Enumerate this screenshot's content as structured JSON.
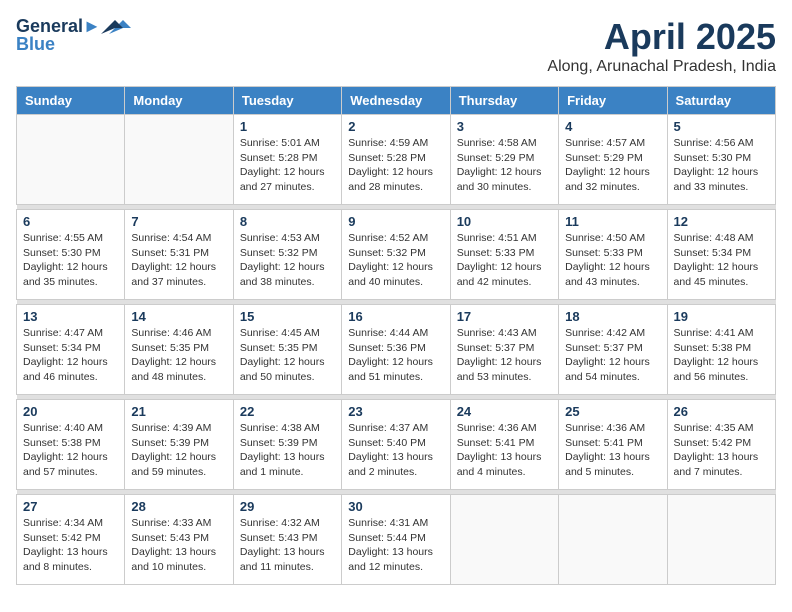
{
  "header": {
    "logo_line1": "General",
    "logo_line2": "Blue",
    "month_title": "April 2025",
    "location": "Along, Arunachal Pradesh, India"
  },
  "weekdays": [
    "Sunday",
    "Monday",
    "Tuesday",
    "Wednesday",
    "Thursday",
    "Friday",
    "Saturday"
  ],
  "weeks": [
    [
      {
        "day": "",
        "info": ""
      },
      {
        "day": "",
        "info": ""
      },
      {
        "day": "1",
        "info": "Sunrise: 5:01 AM\nSunset: 5:28 PM\nDaylight: 12 hours and 27 minutes."
      },
      {
        "day": "2",
        "info": "Sunrise: 4:59 AM\nSunset: 5:28 PM\nDaylight: 12 hours and 28 minutes."
      },
      {
        "day": "3",
        "info": "Sunrise: 4:58 AM\nSunset: 5:29 PM\nDaylight: 12 hours and 30 minutes."
      },
      {
        "day": "4",
        "info": "Sunrise: 4:57 AM\nSunset: 5:29 PM\nDaylight: 12 hours and 32 minutes."
      },
      {
        "day": "5",
        "info": "Sunrise: 4:56 AM\nSunset: 5:30 PM\nDaylight: 12 hours and 33 minutes."
      }
    ],
    [
      {
        "day": "6",
        "info": "Sunrise: 4:55 AM\nSunset: 5:30 PM\nDaylight: 12 hours and 35 minutes."
      },
      {
        "day": "7",
        "info": "Sunrise: 4:54 AM\nSunset: 5:31 PM\nDaylight: 12 hours and 37 minutes."
      },
      {
        "day": "8",
        "info": "Sunrise: 4:53 AM\nSunset: 5:32 PM\nDaylight: 12 hours and 38 minutes."
      },
      {
        "day": "9",
        "info": "Sunrise: 4:52 AM\nSunset: 5:32 PM\nDaylight: 12 hours and 40 minutes."
      },
      {
        "day": "10",
        "info": "Sunrise: 4:51 AM\nSunset: 5:33 PM\nDaylight: 12 hours and 42 minutes."
      },
      {
        "day": "11",
        "info": "Sunrise: 4:50 AM\nSunset: 5:33 PM\nDaylight: 12 hours and 43 minutes."
      },
      {
        "day": "12",
        "info": "Sunrise: 4:48 AM\nSunset: 5:34 PM\nDaylight: 12 hours and 45 minutes."
      }
    ],
    [
      {
        "day": "13",
        "info": "Sunrise: 4:47 AM\nSunset: 5:34 PM\nDaylight: 12 hours and 46 minutes."
      },
      {
        "day": "14",
        "info": "Sunrise: 4:46 AM\nSunset: 5:35 PM\nDaylight: 12 hours and 48 minutes."
      },
      {
        "day": "15",
        "info": "Sunrise: 4:45 AM\nSunset: 5:35 PM\nDaylight: 12 hours and 50 minutes."
      },
      {
        "day": "16",
        "info": "Sunrise: 4:44 AM\nSunset: 5:36 PM\nDaylight: 12 hours and 51 minutes."
      },
      {
        "day": "17",
        "info": "Sunrise: 4:43 AM\nSunset: 5:37 PM\nDaylight: 12 hours and 53 minutes."
      },
      {
        "day": "18",
        "info": "Sunrise: 4:42 AM\nSunset: 5:37 PM\nDaylight: 12 hours and 54 minutes."
      },
      {
        "day": "19",
        "info": "Sunrise: 4:41 AM\nSunset: 5:38 PM\nDaylight: 12 hours and 56 minutes."
      }
    ],
    [
      {
        "day": "20",
        "info": "Sunrise: 4:40 AM\nSunset: 5:38 PM\nDaylight: 12 hours and 57 minutes."
      },
      {
        "day": "21",
        "info": "Sunrise: 4:39 AM\nSunset: 5:39 PM\nDaylight: 12 hours and 59 minutes."
      },
      {
        "day": "22",
        "info": "Sunrise: 4:38 AM\nSunset: 5:39 PM\nDaylight: 13 hours and 1 minute."
      },
      {
        "day": "23",
        "info": "Sunrise: 4:37 AM\nSunset: 5:40 PM\nDaylight: 13 hours and 2 minutes."
      },
      {
        "day": "24",
        "info": "Sunrise: 4:36 AM\nSunset: 5:41 PM\nDaylight: 13 hours and 4 minutes."
      },
      {
        "day": "25",
        "info": "Sunrise: 4:36 AM\nSunset: 5:41 PM\nDaylight: 13 hours and 5 minutes."
      },
      {
        "day": "26",
        "info": "Sunrise: 4:35 AM\nSunset: 5:42 PM\nDaylight: 13 hours and 7 minutes."
      }
    ],
    [
      {
        "day": "27",
        "info": "Sunrise: 4:34 AM\nSunset: 5:42 PM\nDaylight: 13 hours and 8 minutes."
      },
      {
        "day": "28",
        "info": "Sunrise: 4:33 AM\nSunset: 5:43 PM\nDaylight: 13 hours and 10 minutes."
      },
      {
        "day": "29",
        "info": "Sunrise: 4:32 AM\nSunset: 5:43 PM\nDaylight: 13 hours and 11 minutes."
      },
      {
        "day": "30",
        "info": "Sunrise: 4:31 AM\nSunset: 5:44 PM\nDaylight: 13 hours and 12 minutes."
      },
      {
        "day": "",
        "info": ""
      },
      {
        "day": "",
        "info": ""
      },
      {
        "day": "",
        "info": ""
      }
    ]
  ]
}
